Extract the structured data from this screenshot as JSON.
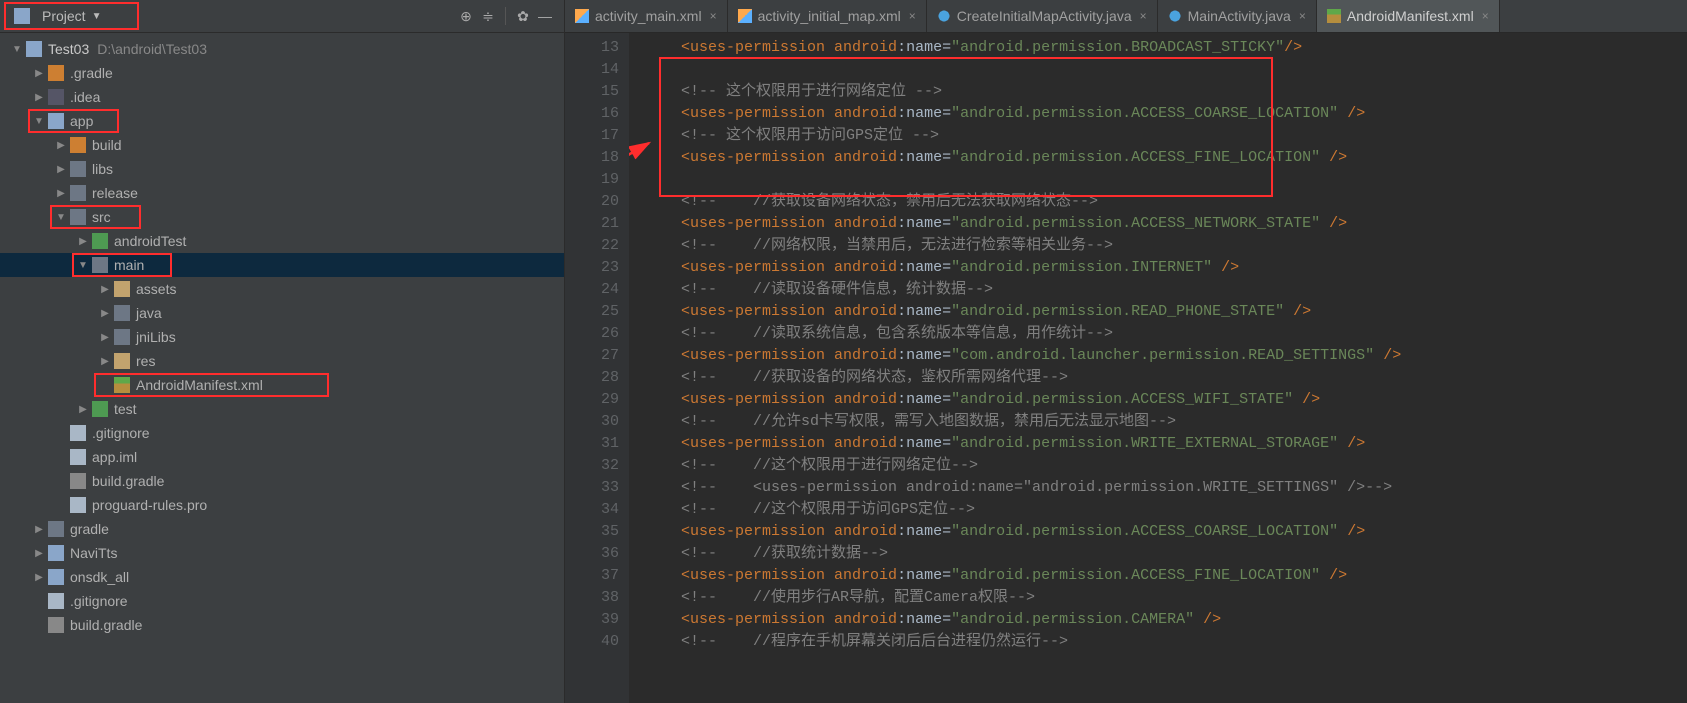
{
  "sidebar": {
    "title": "Project",
    "items": [
      {
        "depth": 0,
        "exp": "▼",
        "icon": "ico-folder-module",
        "label": "Test03",
        "extra": "D:\\android\\Test03",
        "redbox": false
      },
      {
        "depth": 1,
        "exp": "▶",
        "icon": "ico-folder-orange",
        "label": ".gradle"
      },
      {
        "depth": 1,
        "exp": "▶",
        "icon": "ico-folder-special",
        "label": ".idea"
      },
      {
        "depth": 1,
        "exp": "▼",
        "icon": "ico-folder-module",
        "label": "app",
        "redbox": true
      },
      {
        "depth": 2,
        "exp": "▶",
        "icon": "ico-folder-orange",
        "label": "build"
      },
      {
        "depth": 2,
        "exp": "▶",
        "icon": "ico-folder",
        "label": "libs"
      },
      {
        "depth": 2,
        "exp": "▶",
        "icon": "ico-folder",
        "label": "release"
      },
      {
        "depth": 2,
        "exp": "▼",
        "icon": "ico-folder",
        "label": "src",
        "redbox": true
      },
      {
        "depth": 3,
        "exp": "▶",
        "icon": "ico-folder-green",
        "label": "androidTest"
      },
      {
        "depth": 3,
        "exp": "▼",
        "icon": "ico-folder",
        "label": "main",
        "selected": true,
        "redbox": true
      },
      {
        "depth": 4,
        "exp": "▶",
        "icon": "ico-folder-res",
        "label": "assets"
      },
      {
        "depth": 4,
        "exp": "▶",
        "icon": "ico-folder",
        "label": "java"
      },
      {
        "depth": 4,
        "exp": "▶",
        "icon": "ico-folder",
        "label": "jniLibs"
      },
      {
        "depth": 4,
        "exp": "▶",
        "icon": "ico-folder-res",
        "label": "res"
      },
      {
        "depth": 4,
        "exp": "",
        "icon": "ico-manifest",
        "label": "AndroidManifest.xml",
        "redbox": true
      },
      {
        "depth": 3,
        "exp": "▶",
        "icon": "ico-folder-green",
        "label": "test"
      },
      {
        "depth": 2,
        "exp": "",
        "icon": "ico-file",
        "label": ".gitignore"
      },
      {
        "depth": 2,
        "exp": "",
        "icon": "ico-file",
        "label": "app.iml"
      },
      {
        "depth": 2,
        "exp": "",
        "icon": "ico-gradle",
        "label": "build.gradle"
      },
      {
        "depth": 2,
        "exp": "",
        "icon": "ico-file",
        "label": "proguard-rules.pro"
      },
      {
        "depth": 1,
        "exp": "▶",
        "icon": "ico-folder",
        "label": "gradle"
      },
      {
        "depth": 1,
        "exp": "▶",
        "icon": "ico-folder-module",
        "label": "NaviTts"
      },
      {
        "depth": 1,
        "exp": "▶",
        "icon": "ico-folder-module",
        "label": "onsdk_all"
      },
      {
        "depth": 1,
        "exp": "",
        "icon": "ico-file",
        "label": ".gitignore"
      },
      {
        "depth": 1,
        "exp": "",
        "icon": "ico-gradle",
        "label": "build.gradle"
      }
    ]
  },
  "tabs": [
    {
      "icon": "ico-xml",
      "label": "activity_main.xml",
      "closable": true
    },
    {
      "icon": "ico-xml",
      "label": "activity_initial_map.xml",
      "closable": true
    },
    {
      "icon": "ico-java",
      "label": "CreateInitialMapActivity.java",
      "closable": true
    },
    {
      "icon": "ico-java",
      "label": "MainActivity.java",
      "closable": true
    },
    {
      "icon": "ico-manifest",
      "label": "AndroidManifest.xml",
      "closable": true,
      "active": true
    }
  ],
  "code": {
    "first_line": 13,
    "lines": [
      {
        "type": "perm",
        "val": "android.permission.BROADCAST_STICKY",
        "space": false
      },
      {
        "type": "blank"
      },
      {
        "type": "comment_xml",
        "text": "<!-- 这个权限用于进行网络定位 -->"
      },
      {
        "type": "perm",
        "val": "android.permission.ACCESS_COARSE_LOCATION",
        "space": true
      },
      {
        "type": "comment_xml",
        "text": "<!-- 这个权限用于访问GPS定位 -->"
      },
      {
        "type": "perm",
        "val": "android.permission.ACCESS_FINE_LOCATION",
        "space": true
      },
      {
        "type": "blank"
      },
      {
        "type": "comment_slash",
        "text": "<!--    //获取设备网络状态，禁用后无法获取网络状态-->"
      },
      {
        "type": "perm",
        "val": "android.permission.ACCESS_NETWORK_STATE",
        "space": true
      },
      {
        "type": "comment_slash",
        "text": "<!--    //网络权限，当禁用后，无法进行检索等相关业务-->"
      },
      {
        "type": "perm",
        "val": "android.permission.INTERNET",
        "space": true
      },
      {
        "type": "comment_slash",
        "text": "<!--    //读取设备硬件信息，统计数据-->"
      },
      {
        "type": "perm",
        "val": "android.permission.READ_PHONE_STATE",
        "space": true
      },
      {
        "type": "comment_slash",
        "text": "<!--    //读取系统信息，包含系统版本等信息，用作统计-->"
      },
      {
        "type": "perm",
        "val": "com.android.launcher.permission.READ_SETTINGS",
        "space": true
      },
      {
        "type": "comment_slash",
        "text": "<!--    //获取设备的网络状态，鉴权所需网络代理-->"
      },
      {
        "type": "perm",
        "val": "android.permission.ACCESS_WIFI_STATE",
        "space": true
      },
      {
        "type": "comment_slash",
        "text": "<!--    //允许sd卡写权限，需写入地图数据，禁用后无法显示地图-->"
      },
      {
        "type": "perm",
        "val": "android.permission.WRITE_EXTERNAL_STORAGE",
        "space": true
      },
      {
        "type": "comment_slash",
        "text": "<!--    //这个权限用于进行网络定位-->"
      },
      {
        "type": "comment_slash",
        "text": "<!--    <uses-permission android:name=\"android.permission.WRITE_SETTINGS\" />-->"
      },
      {
        "type": "comment_slash",
        "text": "<!--    //这个权限用于访问GPS定位-->"
      },
      {
        "type": "perm",
        "val": "android.permission.ACCESS_COARSE_LOCATION",
        "space": true
      },
      {
        "type": "comment_slash",
        "text": "<!--    //获取统计数据-->"
      },
      {
        "type": "perm",
        "val": "android.permission.ACCESS_FINE_LOCATION",
        "space": true
      },
      {
        "type": "comment_slash",
        "text": "<!--    //使用步行AR导航，配置Camera权限-->"
      },
      {
        "type": "perm",
        "val": "android.permission.CAMERA",
        "space": true
      },
      {
        "type": "comment_slash",
        "text": "<!--    //程序在手机屏幕关闭后后台进程仍然运行-->"
      }
    ]
  },
  "highlight_box": {
    "start_line_idx": 1,
    "end_line_idx": 6
  }
}
